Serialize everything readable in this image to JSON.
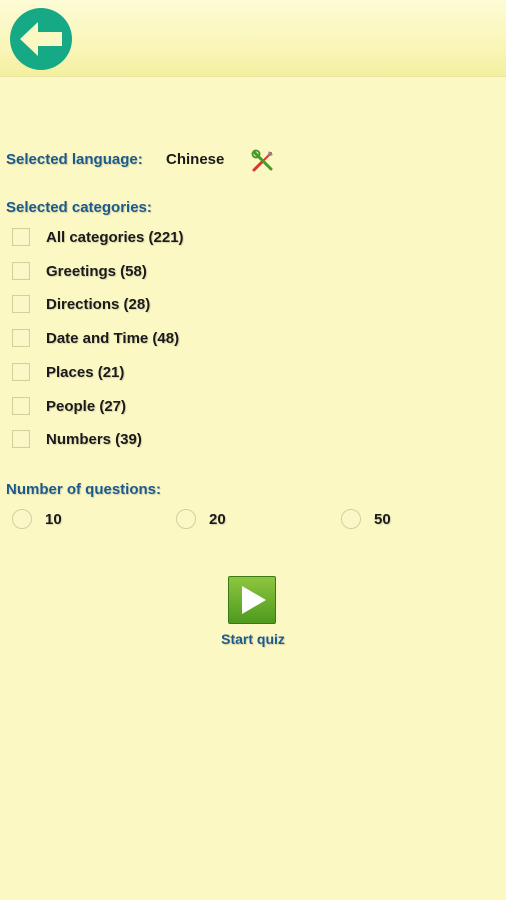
{
  "header": {
    "back_icon": "back-arrow-icon"
  },
  "language": {
    "label": "Selected language:",
    "value": "Chinese",
    "edit_icon": "tools-icon"
  },
  "categories": {
    "label": "Selected categories:",
    "items": [
      {
        "label": "All categories (221)",
        "checked": false
      },
      {
        "label": "Greetings (58)",
        "checked": false
      },
      {
        "label": "Directions (28)",
        "checked": false
      },
      {
        "label": "Date and Time (48)",
        "checked": false
      },
      {
        "label": "Places (21)",
        "checked": false
      },
      {
        "label": "People (27)",
        "checked": false
      },
      {
        "label": "Numbers (39)",
        "checked": false
      }
    ]
  },
  "questions": {
    "label": "Number of questions:",
    "options": [
      {
        "label": "10",
        "selected": false
      },
      {
        "label": "20",
        "selected": false
      },
      {
        "label": "50",
        "selected": false
      }
    ]
  },
  "start": {
    "label": "Start quiz",
    "icon": "play-icon"
  },
  "colors": {
    "background": "#fbf8c4",
    "accent_blue": "#1c5a8c",
    "back_button": "#16a986",
    "play_green": "#5aa82a"
  }
}
